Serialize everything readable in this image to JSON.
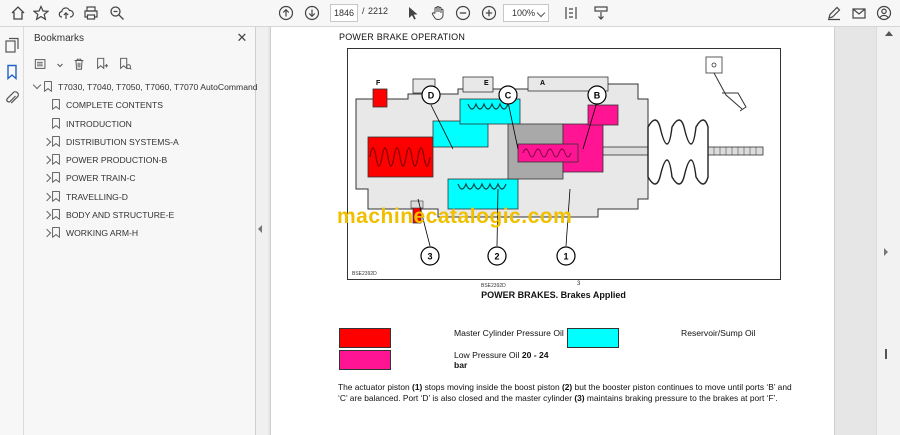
{
  "toolbar": {
    "page_current": "1846",
    "page_separator": "/",
    "page_total": "2212",
    "zoom": "100%"
  },
  "bookmarks": {
    "title": "Bookmarks",
    "items": [
      {
        "label": "T7030, T7040, T7050, T7060, T7070 AutoCommand",
        "level": 0,
        "expander": "down"
      },
      {
        "label": "COMPLETE CONTENTS",
        "level": 1,
        "expander": "none"
      },
      {
        "label": "INTRODUCTION",
        "level": 1,
        "expander": "none"
      },
      {
        "label": "DISTRIBUTION SYSTEMS-A",
        "level": 1,
        "expander": "right"
      },
      {
        "label": "POWER PRODUCTION-B",
        "level": 1,
        "expander": "right"
      },
      {
        "label": "POWER TRAIN-C",
        "level": 1,
        "expander": "right"
      },
      {
        "label": "TRAVELLING-D",
        "level": 1,
        "expander": "right"
      },
      {
        "label": "BODY AND STRUCTURE-E",
        "level": 1,
        "expander": "right"
      },
      {
        "label": "WORKING ARM-H",
        "level": 1,
        "expander": "right"
      }
    ]
  },
  "document": {
    "heading": "POWER BRAKE OPERATION",
    "figure_code": "BSE2392D",
    "figure_code_small": "BSE2392D",
    "figure_number": "3",
    "caption": "POWER BRAKES. Brakes Applied",
    "callouts_letters": [
      "D",
      "C",
      "B"
    ],
    "port_labels": [
      "F",
      "E",
      "A"
    ],
    "callouts_numbers": [
      "3",
      "2",
      "1"
    ],
    "watermark": "machinecatalogic.com",
    "legend": [
      {
        "color": "#ff0000",
        "label": "Master Cylinder Pressure Oil",
        "label_bold": ""
      },
      {
        "color": "#00ffff",
        "label": "Reservoir/Sump Oil",
        "label_bold": ""
      },
      {
        "color": "#ff1493",
        "label": "Low Pressure Oil ",
        "label_bold": "20 - 24 bar"
      }
    ],
    "body_text": [
      {
        "t": "The actuator piston ",
        "b": false
      },
      {
        "t": "(1)",
        "b": true
      },
      {
        "t": " stops moving inside the boost piston ",
        "b": false
      },
      {
        "t": "(2)",
        "b": true
      },
      {
        "t": " but the booster piston continues to move until ports ‘B’ and ‘C’ are balanced. Port ‘D’ is also closed and the master cylinder ",
        "b": false
      },
      {
        "t": "(3)",
        "b": true
      },
      {
        "t": " maintains braking pressure to the brakes at port ‘F’.",
        "b": false
      }
    ]
  },
  "colors": {
    "master": "#ff0000",
    "reservoir": "#00ffff",
    "low_pressure": "#ff1493",
    "watermark": "#f0c000",
    "accent": "#2262c6"
  }
}
